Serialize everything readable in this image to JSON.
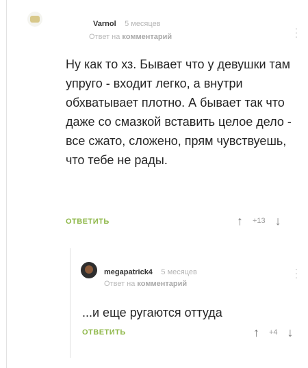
{
  "comments": [
    {
      "author": "Varnol",
      "time": "5 месяцев",
      "reply_prefix": "Ответ на",
      "reply_target": "комментарий",
      "text": "Ну как то хз. Бывает что у девушки там упруго - входит легко, а внутри обхватывает плотно. А бывает так что даже со смазкой вставить целое дело - все сжато, сложено, прям чувствуешь, что тебе не рады.",
      "reply_label": "ОТВЕТИТЬ",
      "up_icon": "arrow-up-icon",
      "down_icon": "arrow-down-icon",
      "score": "+13"
    },
    {
      "author": "megapatrick4",
      "time": "5 месяцев",
      "reply_prefix": "Ответ на",
      "reply_target": "комментарий",
      "text": "...и еще ругаются оттуда",
      "reply_label": "ОТВЕТИТЬ",
      "up_icon": "arrow-up-icon",
      "down_icon": "arrow-down-icon",
      "score": "+4"
    }
  ],
  "colors": {
    "reply_button": "#8fb84a",
    "muted_text": "#b5b5b5"
  }
}
